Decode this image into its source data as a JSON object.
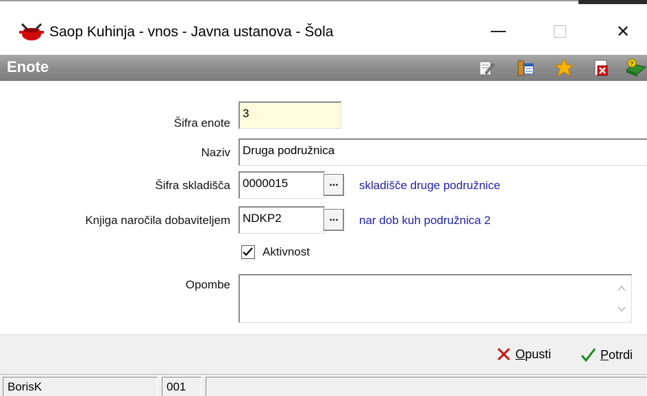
{
  "window": {
    "title": "Saop Kuhinja - vnos - Javna ustanova - Šola",
    "app_icon": "cooking-pot-icon",
    "controls": {
      "minimize": "minimize",
      "maximize": "maximize",
      "close": "✕"
    }
  },
  "header": {
    "title": "Enote",
    "toolbar_icons": [
      "edit-note-icon",
      "columns-icon",
      "favorite-star-icon",
      "delete-document-icon",
      "help-books-icon"
    ],
    "star_color": "#f5b400"
  },
  "form": {
    "code": {
      "label": "Šifra enote",
      "value": "3"
    },
    "name": {
      "label": "Naziv",
      "value": "Druga podružnica"
    },
    "warehouse": {
      "label": "Šifra skladišča",
      "value": "0000015",
      "browse": "...",
      "description": "skladišče druge podružnice"
    },
    "order_book": {
      "label": "Knjiga naročila dobaviteljem",
      "value": "NDKP2",
      "browse": "...",
      "description": "nar dob kuh podružnica 2"
    },
    "active": {
      "label": "Aktivnost",
      "checked": true
    },
    "notes": {
      "label": "Opombe",
      "value": ""
    }
  },
  "actions": {
    "cancel": {
      "mnemonic": "O",
      "rest": "pusti"
    },
    "confirm": {
      "mnemonic": "P",
      "rest": "otrdi"
    },
    "cancel_color": "#cc1111",
    "confirm_color": "#1a8a1a"
  },
  "status": {
    "user": "BorisK",
    "code": "001",
    "message": ""
  },
  "colors": {
    "header_band": "#8d8d8d",
    "description_text": "#2020b0",
    "required_field": "#fffbdc"
  }
}
